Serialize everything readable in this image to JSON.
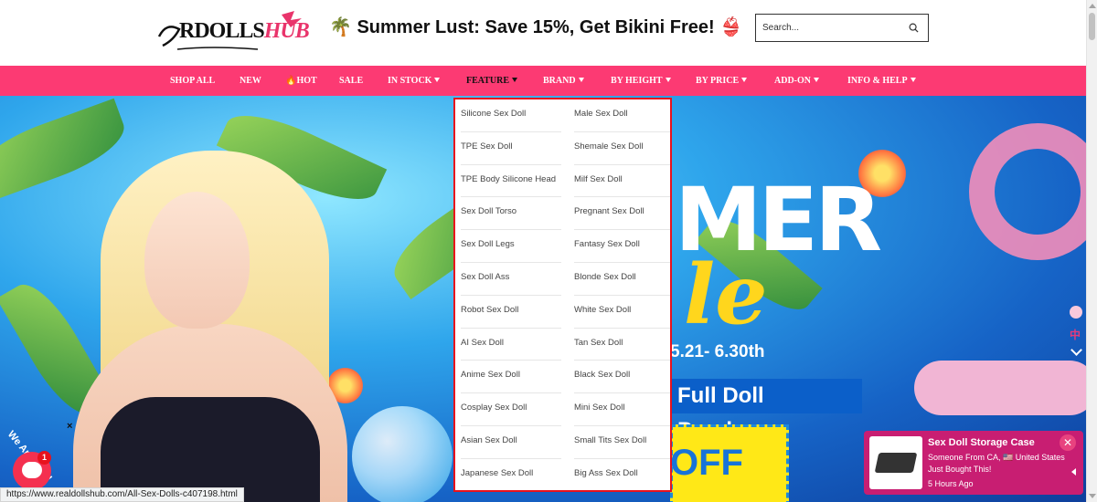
{
  "header": {
    "logo_text_main": "RDOLLS",
    "logo_text_accent": "HUB",
    "promo": "🌴 Summer Lust: Save 15%, Get Bikini Free! 👙",
    "search_placeholder": "Search..."
  },
  "nav": {
    "items": [
      {
        "label": "SHOP ALL",
        "caret": false
      },
      {
        "label": "NEW",
        "caret": false
      },
      {
        "label": "🔥HOT",
        "caret": false
      },
      {
        "label": "SALE",
        "caret": false
      },
      {
        "label": "IN STOCK",
        "caret": true
      },
      {
        "label": "FEATURE",
        "caret": true,
        "active": true
      },
      {
        "label": "BRAND",
        "caret": true
      },
      {
        "label": "BY HEIGHT",
        "caret": true
      },
      {
        "label": "BY PRICE",
        "caret": true
      },
      {
        "label": "ADD-ON",
        "caret": true
      },
      {
        "label": "INFO & HELP",
        "caret": true
      }
    ]
  },
  "hero": {
    "big_letters": "MER",
    "script": "le",
    "dates": "5.21- 6.30th",
    "purchase": "Full Doll Purchase",
    "off": "OFF"
  },
  "dropdown": {
    "col1": [
      "Silicone Sex Doll",
      "TPE Sex Doll",
      "TPE Body Silicone Head",
      "Sex Doll Torso",
      "Sex Doll Legs",
      "Sex Doll Ass",
      "Robot Sex Doll",
      "AI Sex Doll",
      "Anime Sex Doll",
      "Cosplay Sex Doll",
      "Asian Sex Doll",
      "Japanese Sex Doll"
    ],
    "col2": [
      "Male Sex Doll",
      "Shemale Sex Doll",
      "Milf Sex Doll",
      "Pregnant Sex Doll",
      "Fantasy Sex Doll",
      "Blonde Sex Doll",
      "White Sex Doll",
      "Tan Sex Doll",
      "Black Sex Doll",
      "Mini Sex Doll",
      "Small Tits Sex Doll",
      "Big Ass Sex Doll"
    ]
  },
  "status_link": "https://www.realdollshub.com/All-Sex-Dolls-c407198.html",
  "chat": {
    "tag": "We Are Here!",
    "badge": "1",
    "close": "×"
  },
  "notification": {
    "title": "Sex Doll Storage Case",
    "message": "Someone From CA, 🇺🇸 United States Just Bought This!",
    "time": "5 Hours Ago",
    "close": "✕"
  },
  "side_widget": {
    "lang": "中"
  },
  "colors": {
    "nav_bg": "#fc3a73",
    "dropdown_border": "#e8121d",
    "notification_bg": "#c81e72",
    "chat_button": "#f4304f"
  }
}
